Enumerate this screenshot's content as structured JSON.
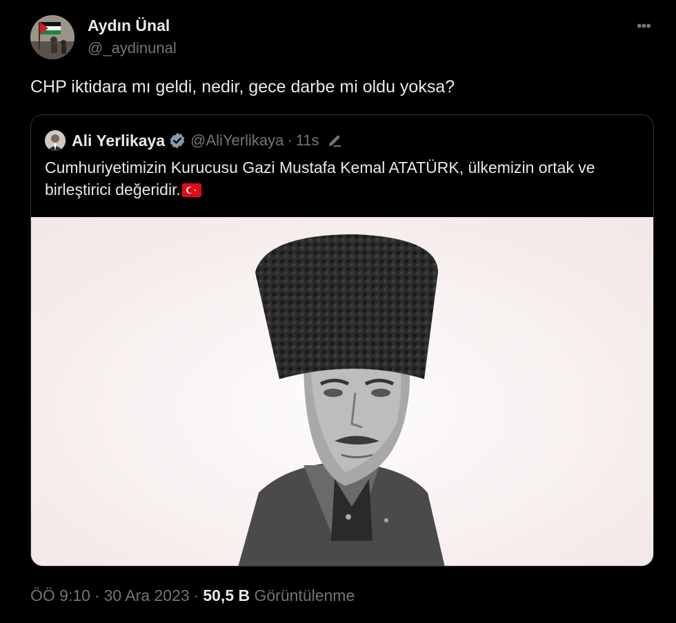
{
  "tweet": {
    "author_name": "Aydın Ünal",
    "author_handle": "@_aydinunal",
    "more_label": "•••",
    "text": "CHP iktidara mı geldi, nedir, gece darbe mi oldu yoksa?",
    "avatar_icon": "profile-photo-flag",
    "time": "ÖÖ 9:10",
    "date": "30 Ara 2023",
    "separator": "·",
    "views_count": "50,5 B",
    "views_label": "Görüntülenme"
  },
  "quote": {
    "author_name": "Ali Yerlikaya",
    "author_handle": "@AliYerlikaya",
    "separator": "·",
    "time": "11s",
    "verified_icon": "verified-badge-icon",
    "edited_icon": "pencil-edit-icon",
    "text": "Cumhuriyetimizin Kurucusu Gazi Mustafa Kemal ATATÜRK, ülkemizin ortak ve birleştirici değeridir.",
    "emoji": "turkey-flag-icon",
    "image": "portrait-photo"
  },
  "colors": {
    "background": "#000000",
    "text_primary": "#e7e9ea",
    "text_secondary": "#71767b",
    "border": "#2f3336",
    "verified": "#829aab"
  }
}
